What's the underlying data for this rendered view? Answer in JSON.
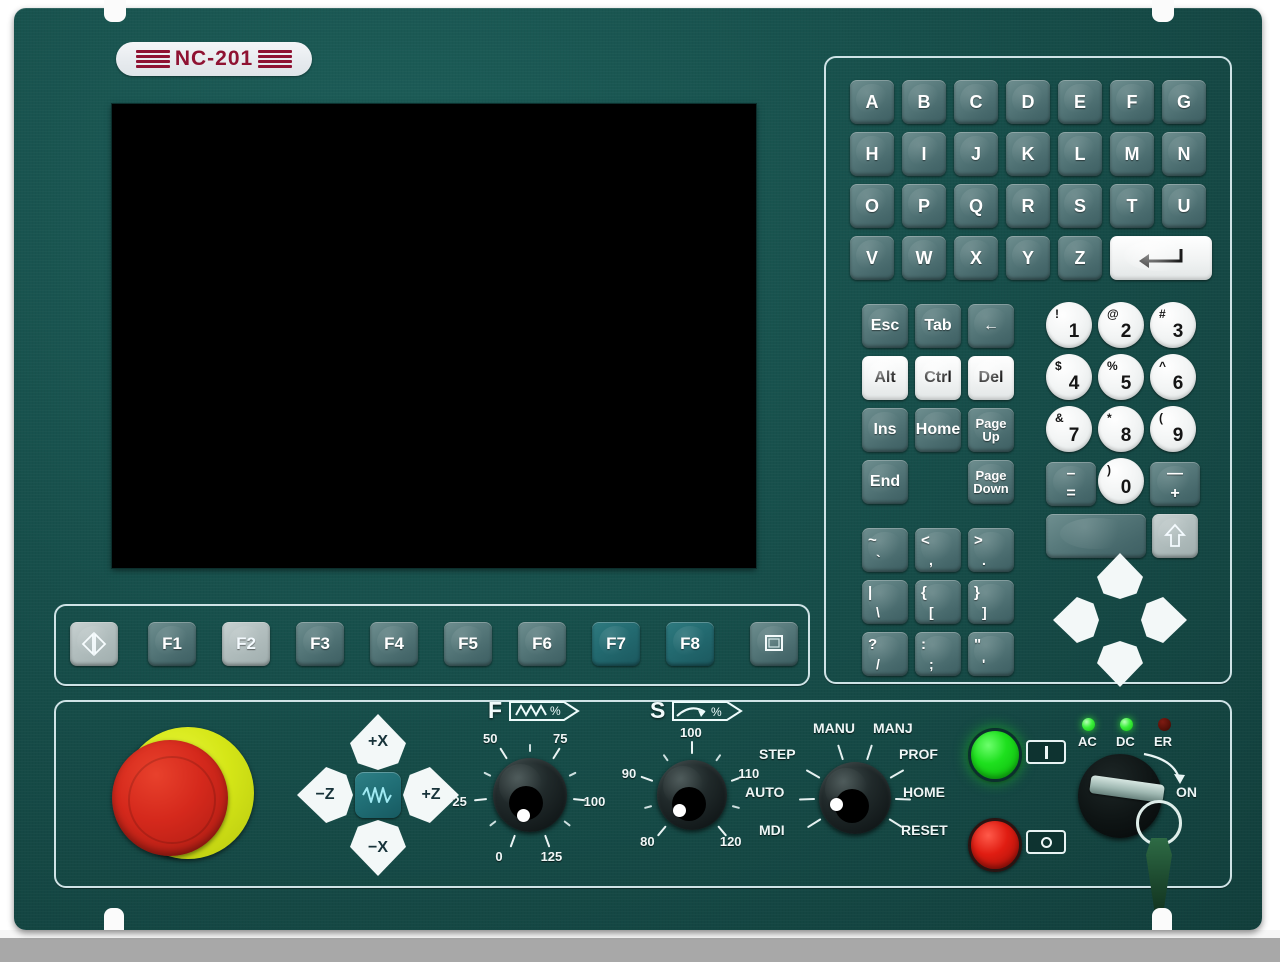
{
  "device": {
    "brand_badge": "NC-201",
    "badge_icon": "brand-stripes"
  },
  "screen": {
    "state": "blank-black",
    "label": "lcd-display"
  },
  "keyboard": {
    "alpha_rows": [
      [
        "A",
        "B",
        "C",
        "D",
        "E",
        "F",
        "G"
      ],
      [
        "H",
        "I",
        "J",
        "K",
        "L",
        "M",
        "N"
      ],
      [
        "O",
        "P",
        "Q",
        "R",
        "S",
        "T",
        "U"
      ]
    ],
    "last_alpha_row": [
      "V",
      "W",
      "X",
      "Y",
      "Z"
    ],
    "enter_key": {
      "label": "Enter",
      "icon": "enter-arrow-icon"
    },
    "control_keys": [
      {
        "label": "Esc",
        "style": "teal"
      },
      {
        "label": "Tab",
        "style": "teal"
      },
      {
        "label": "←",
        "style": "teal",
        "icon": "backspace-icon"
      },
      {
        "label": "Alt",
        "style": "white"
      },
      {
        "label": "Ctrl",
        "style": "white"
      },
      {
        "label": "Del",
        "style": "white"
      },
      {
        "label": "Ins",
        "style": "teal"
      },
      {
        "label": "Home",
        "style": "teal"
      },
      {
        "label": "Page Up",
        "line1": "Page",
        "line2": "Up",
        "style": "teal"
      },
      {
        "label": "End",
        "style": "teal"
      },
      {
        "label": "Page Down",
        "line1": "Page",
        "line2": "Down",
        "style": "teal"
      }
    ],
    "symbol_keys": [
      {
        "upper": "~",
        "lower": "`"
      },
      {
        "upper": "<",
        "lower": ","
      },
      {
        "upper": ">",
        "lower": "."
      },
      {
        "upper": "|",
        "lower": "\\"
      },
      {
        "upper": "{",
        "lower": "["
      },
      {
        "upper": "}",
        "lower": "]"
      },
      {
        "upper": "?",
        "lower": "/"
      },
      {
        "upper": ":",
        "lower": ";"
      },
      {
        "upper": "\"",
        "lower": "'"
      }
    ],
    "numeric_keys": [
      {
        "digit": "1",
        "shift": "!"
      },
      {
        "digit": "2",
        "shift": "@"
      },
      {
        "digit": "3",
        "shift": "#"
      },
      {
        "digit": "4",
        "shift": "$"
      },
      {
        "digit": "5",
        "shift": "%"
      },
      {
        "digit": "6",
        "shift": "^"
      },
      {
        "digit": "7",
        "shift": "&"
      },
      {
        "digit": "8",
        "shift": "*"
      },
      {
        "digit": "9",
        "shift": "("
      },
      {
        "digit": "0",
        "shift": ")"
      }
    ],
    "minus_equals_key": {
      "upper": "–",
      "lower": "="
    },
    "minus_plus_key": {
      "upper": "—",
      "lower": "+"
    },
    "space_key": {
      "label": "Space"
    },
    "shift_key": {
      "label": "Shift",
      "icon": "shift-up-arrow-icon"
    },
    "arrow_pad": [
      {
        "dir": "up",
        "icon": "arrow-up-icon"
      },
      {
        "dir": "left",
        "icon": "arrow-left-icon"
      },
      {
        "dir": "right",
        "icon": "arrow-right-icon"
      },
      {
        "dir": "down",
        "icon": "arrow-down-icon"
      }
    ]
  },
  "function_row": {
    "left_key": {
      "label": "",
      "icon": "left-right-arrows-icon",
      "style": "lite"
    },
    "keys": [
      {
        "label": "F1",
        "style": "teal"
      },
      {
        "label": "F2",
        "style": "lite"
      },
      {
        "label": "F3",
        "style": "teal"
      },
      {
        "label": "F4",
        "style": "teal"
      },
      {
        "label": "F5",
        "style": "teal"
      },
      {
        "label": "F6",
        "style": "teal"
      },
      {
        "label": "F7",
        "style": "teal-bright"
      },
      {
        "label": "F8",
        "style": "teal-bright"
      }
    ],
    "right_key": {
      "label": "",
      "icon": "window-screen-icon",
      "style": "teal"
    }
  },
  "operator_panel": {
    "emergency_stop": {
      "label": "Emergency Stop",
      "button_color": "#d5291c",
      "base_color": "#d5e617"
    },
    "jog_keys": {
      "up": "+X",
      "down": "−X",
      "left": "−Z",
      "right": "+Z",
      "center": {
        "label": "Rapid",
        "icon": "rapid-wave-icon"
      }
    },
    "feed_override": {
      "letter": "F",
      "icon": "feed-override-icon",
      "scale_values": [
        "0",
        "25",
        "50",
        "75",
        "100",
        "125"
      ],
      "unit": "%",
      "current_position": "0"
    },
    "spindle_override": {
      "letter": "S",
      "icon": "spindle-override-icon",
      "scale_values": [
        "80",
        "90",
        "100",
        "110",
        "120"
      ],
      "unit": "%",
      "current_position": "80"
    },
    "mode_selector": {
      "positions": [
        "MANU",
        "MANJ",
        "STEP",
        "PROF",
        "AUTO",
        "HOME",
        "MDI",
        "RESET"
      ],
      "current_position": "MDI"
    },
    "start_button": {
      "label": "Start",
      "symbol": "I",
      "color": "#1ee01e"
    },
    "stop_button": {
      "label": "Stop",
      "symbol": "O",
      "color": "#e01d12"
    },
    "indicators": [
      {
        "label": "AC",
        "state": "on",
        "color": "#3bf03b"
      },
      {
        "label": "DC",
        "state": "on",
        "color": "#3bf03b"
      },
      {
        "label": "ER",
        "state": "off",
        "color": "#561008"
      }
    ],
    "key_switch": {
      "label": "ON",
      "icon": "key-switch-icon",
      "state": "on"
    }
  }
}
